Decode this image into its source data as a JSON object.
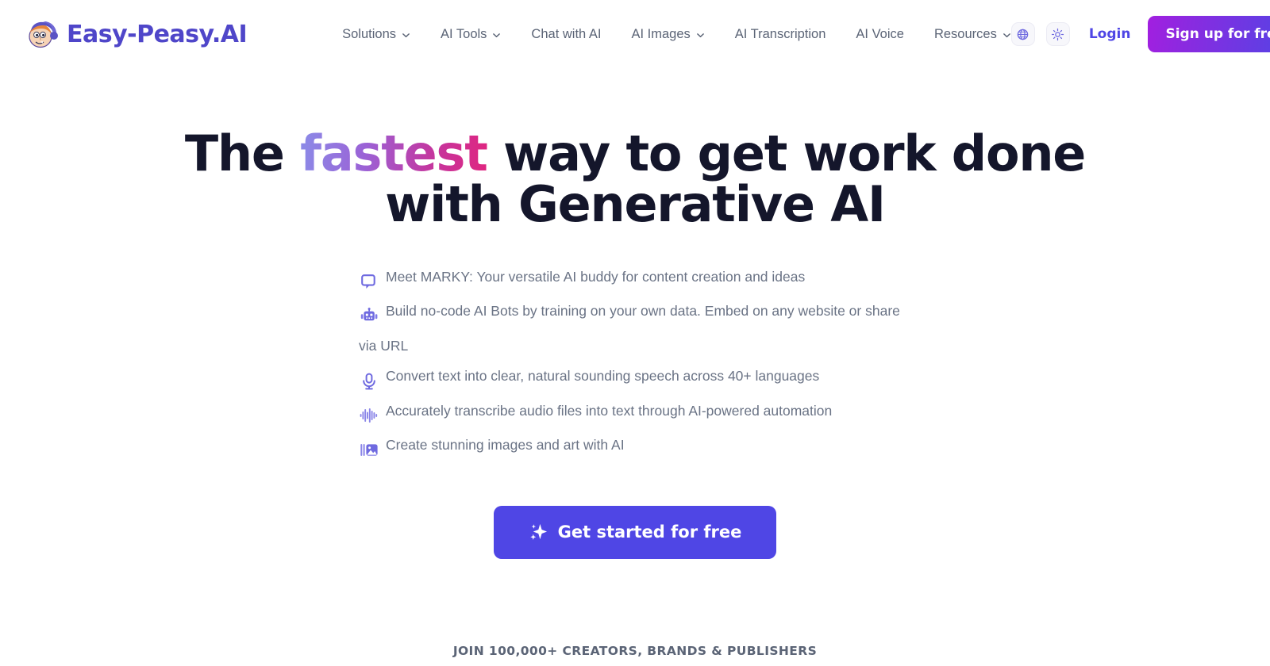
{
  "brand": {
    "name": "Easy-Peasy.AI",
    "logo_icon": "mascot-face-icon",
    "color": "#4f46c9"
  },
  "nav": {
    "items": [
      {
        "label": "Solutions",
        "has_dropdown": true,
        "icon": "chevron-down-icon"
      },
      {
        "label": "AI Tools",
        "has_dropdown": true,
        "icon": "chevron-down-icon"
      },
      {
        "label": "Chat with AI",
        "has_dropdown": false
      },
      {
        "label": "AI Images",
        "has_dropdown": true,
        "icon": "chevron-down-icon"
      },
      {
        "label": "AI Transcription",
        "has_dropdown": false
      },
      {
        "label": "AI Voice",
        "has_dropdown": false
      },
      {
        "label": "Resources",
        "has_dropdown": true,
        "icon": "chevron-down-icon"
      }
    ]
  },
  "header_actions": {
    "language_icon": "globe-icon",
    "theme_icon": "sun-icon",
    "login_label": "Login",
    "login_color": "#4f46e5",
    "signup_label": "Sign up for free",
    "signup_gradient_from": "#a21fe0",
    "signup_gradient_to": "#4f46e5"
  },
  "hero": {
    "headline_part1": "The ",
    "headline_highlight": "fastest",
    "headline_part2": " way to get work done",
    "headline_line2": "with Generative AI",
    "highlight_gradient_from": "#8b8ce8",
    "highlight_gradient_to": "#e0257f"
  },
  "features": [
    {
      "icon": "chat-bubble-icon",
      "text": "Meet MARKY: Your versatile AI buddy for content creation and ideas"
    },
    {
      "icon": "robot-icon",
      "text": "Build no-code AI Bots by training on your own data. Embed on any website or share via URL"
    },
    {
      "icon": "microphone-icon",
      "text": "Convert text into clear, natural sounding speech across 40+ languages"
    },
    {
      "icon": "waveform-icon",
      "text": "Accurately transcribe audio files into text through AI-powered automation"
    },
    {
      "icon": "image-icon",
      "text": "Create stunning images and art with AI"
    }
  ],
  "cta": {
    "label": "Get started for free",
    "icon": "sparkle-icon",
    "color": "#4f46e5"
  },
  "social_proof": {
    "text": "JOIN 100,000+ CREATORS, BRANDS & PUBLISHERS"
  }
}
